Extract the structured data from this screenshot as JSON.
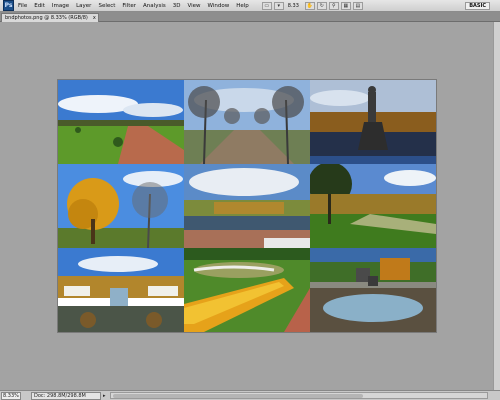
{
  "app": {
    "logo": "Ps"
  },
  "menu": [
    "File",
    "Edit",
    "Image",
    "Layer",
    "Select",
    "Filter",
    "Analysis",
    "3D",
    "View",
    "Window",
    "Help"
  ],
  "toolbar": {
    "zoom": "8.33",
    "workspace": "BASIC"
  },
  "document": {
    "tab_title": "bndphotos.png @ 8.33% (RGB/8)",
    "close_symbol": "x"
  },
  "status": {
    "zoom": "8.33%",
    "doc_info": "Doc: 298.8M/298.8M",
    "arrow": "▸"
  },
  "icons": {
    "tools": [
      "screen-mode-icon",
      "zoom-level-icon",
      "hand-icon",
      "rotate-view-icon",
      "arrange-documents-icon",
      "extras-icon"
    ]
  },
  "photos": [
    {
      "name": "photo-park-lawn",
      "scene": "Sunny park with lawn and path under blue sky"
    },
    {
      "name": "photo-tree-alley",
      "scene": "Alley of bare trees"
    },
    {
      "name": "photo-fountain-statue",
      "scene": "Fountain with golden statue"
    },
    {
      "name": "photo-autumn-tree",
      "scene": "Yellow autumn tree"
    },
    {
      "name": "photo-canal-building",
      "scene": "Canal with palace building"
    },
    {
      "name": "photo-green-garden",
      "scene": "Green garden with trees"
    },
    {
      "name": "photo-palace-cascade",
      "scene": "Palace and cascade"
    },
    {
      "name": "photo-flower-bed",
      "scene": "Orange flower beds"
    },
    {
      "name": "photo-pond-fountain",
      "scene": "Pond with fountain"
    }
  ]
}
